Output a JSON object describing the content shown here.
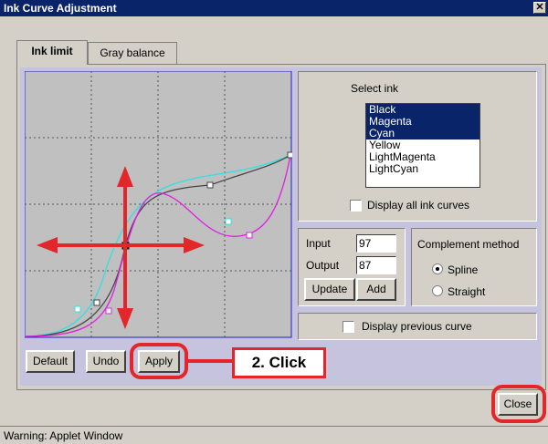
{
  "window": {
    "title": "Ink Curve Adjustment",
    "close_glyph": "✕"
  },
  "tabs": [
    {
      "label": "Ink limit",
      "active": true
    },
    {
      "label": "Gray balance",
      "active": false
    }
  ],
  "select_ink": {
    "label": "Select ink",
    "items": [
      {
        "label": "Black",
        "selected": true
      },
      {
        "label": "Magenta",
        "selected": true
      },
      {
        "label": "Cyan",
        "selected": true
      },
      {
        "label": "Yellow",
        "selected": false
      },
      {
        "label": "LightMagenta",
        "selected": false
      },
      {
        "label": "LightCyan",
        "selected": false
      }
    ],
    "display_all_label": "Display all ink curves"
  },
  "io": {
    "input_label": "Input",
    "input_value": "97",
    "output_label": "Output",
    "output_value": "87",
    "update_label": "Update",
    "add_label": "Add"
  },
  "complement": {
    "label": "Complement method",
    "spline_label": "Spline",
    "straight_label": "Straight",
    "selected": "Spline"
  },
  "display_previous_label": "Display previous curve",
  "buttons": {
    "default": "Default",
    "undo": "Undo",
    "apply": "Apply",
    "close": "Close"
  },
  "callout": {
    "text": "2. Click"
  },
  "status": {
    "text": "Warning: Applet Window"
  },
  "colors": {
    "black_curve": "#444444",
    "magenta_curve": "#e020e0",
    "cyan_curve": "#30e0e0",
    "arrow": "#e3262a",
    "highlight": "#e3262a"
  }
}
